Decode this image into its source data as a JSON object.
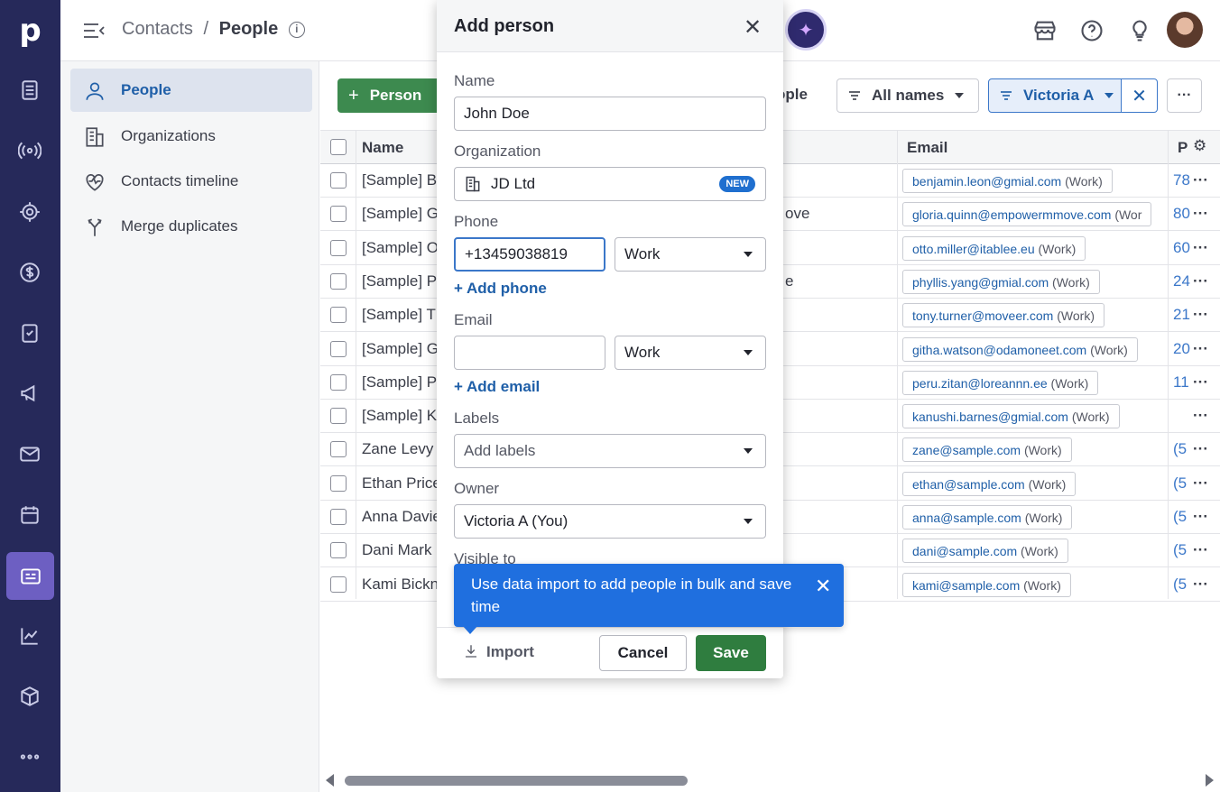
{
  "app": {
    "logo": "p"
  },
  "breadcrumb": {
    "parent": "Contacts",
    "separator": "/",
    "current": "People",
    "info_icon": "i"
  },
  "sidebar": {
    "items": [
      {
        "label": "People",
        "icon": "person-icon",
        "active": true
      },
      {
        "label": "Organizations",
        "icon": "building-icon"
      },
      {
        "label": "Contacts timeline",
        "icon": "heart-pulse-icon"
      },
      {
        "label": "Merge duplicates",
        "icon": "merge-icon"
      }
    ]
  },
  "toolbar": {
    "add_person": "Person",
    "add_plus": "+",
    "people_partial": "ople",
    "all_names": "All names",
    "owner_filter": "Victoria A",
    "owner_filter_clear": "✕",
    "more": "···"
  },
  "table": {
    "headers": {
      "name": "Name",
      "email": "Email",
      "phone": "P"
    },
    "rows": [
      {
        "name": "[Sample] B",
        "org": "",
        "email": "benjamin.leon@gmial.com",
        "email_type": "(Work)",
        "phone": "78"
      },
      {
        "name": "[Sample] G",
        "org": "ove",
        "email": "gloria.quinn@empowermmove.com",
        "email_type": "(Wor",
        "phone": "80"
      },
      {
        "name": "[Sample] O",
        "org": "",
        "email": "otto.miller@itablee.eu",
        "email_type": "(Work)",
        "phone": "60"
      },
      {
        "name": "[Sample] P",
        "org": "e",
        "email": "phyllis.yang@gmial.com",
        "email_type": "(Work)",
        "phone": "24"
      },
      {
        "name": "[Sample] T",
        "org": "",
        "email": "tony.turner@moveer.com",
        "email_type": "(Work)",
        "phone": "21"
      },
      {
        "name": "[Sample] G",
        "org": "",
        "email": "githa.watson@odamoneet.com",
        "email_type": "(Work)",
        "phone": "20"
      },
      {
        "name": "[Sample] P",
        "org": "",
        "email": "peru.zitan@loreannn.ee",
        "email_type": "(Work)",
        "phone": "11"
      },
      {
        "name": "[Sample] K",
        "org": "",
        "email": "kanushi.barnes@gmial.com",
        "email_type": "(Work)",
        "phone": ""
      },
      {
        "name": "Zane Levy",
        "org": "",
        "email": "zane@sample.com",
        "email_type": "(Work)",
        "phone": "(5"
      },
      {
        "name": "Ethan Price",
        "org": "",
        "email": "ethan@sample.com",
        "email_type": "(Work)",
        "phone": "(5"
      },
      {
        "name": "Anna Davie",
        "org": "",
        "email": "anna@sample.com",
        "email_type": "(Work)",
        "phone": "(5"
      },
      {
        "name": "Dani Mark",
        "org": "",
        "email": "dani@sample.com",
        "email_type": "(Work)",
        "phone": "(5"
      },
      {
        "name": "Kami Bickn",
        "org": "",
        "email": "kami@sample.com",
        "email_type": "(Work)",
        "phone": "(5"
      }
    ],
    "row_menu": "···"
  },
  "modal": {
    "title": "Add person",
    "close": "✕",
    "name_label": "Name",
    "name_value": "John Doe",
    "org_label": "Organization",
    "org_value": "JD Ltd",
    "org_badge": "NEW",
    "phone_label": "Phone",
    "phone_value": "+13459038819",
    "phone_type": "Work",
    "add_phone": "+ Add phone",
    "email_label": "Email",
    "email_value": "",
    "email_type": "Work",
    "add_email": "+ Add email",
    "labels_label": "Labels",
    "labels_placeholder": "Add labels",
    "owner_label": "Owner",
    "owner_value": "Victoria A (You)",
    "visible_label": "Visible to",
    "import": "Import",
    "cancel": "Cancel",
    "save": "Save"
  },
  "tooltip": {
    "text": "Use data import to add people in bulk and save time",
    "close": "✕"
  },
  "colors": {
    "rail": "#26295a",
    "primary_green": "#2f7d3f",
    "link_blue": "#1f5fa8",
    "tooltip_blue": "#1f6fdf"
  }
}
